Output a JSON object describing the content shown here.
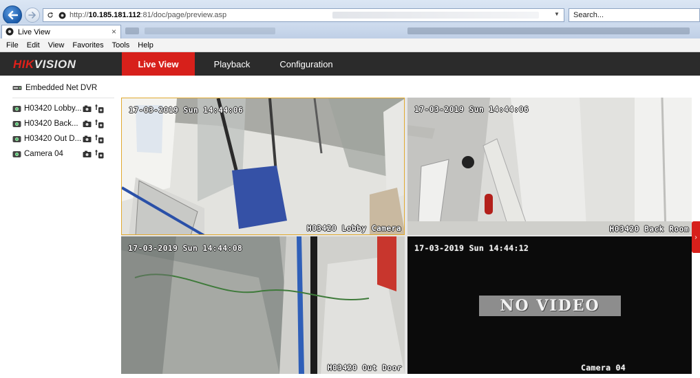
{
  "browser": {
    "url_prefix": "http://",
    "url_host": "10.185.181.112",
    "url_rest": ":81/doc/page/preview.asp",
    "search_placeholder": "Search...",
    "tab_title": "Live View",
    "tab_close": "×",
    "menu": [
      "File",
      "Edit",
      "View",
      "Favorites",
      "Tools",
      "Help"
    ]
  },
  "app": {
    "logo_red": "HIK",
    "logo_white": "VISION",
    "nav": {
      "live_view": "Live View",
      "playback": "Playback",
      "configuration": "Configuration"
    },
    "accent_color": "#d7201b",
    "header_bg": "#2b2b2b"
  },
  "tree": {
    "device": "Embedded Net DVR",
    "cameras": [
      {
        "label": "H03420 Lobby..."
      },
      {
        "label": "H03420 Back..."
      },
      {
        "label": "H03420 Out D..."
      },
      {
        "label": "Camera 04"
      }
    ]
  },
  "views": [
    {
      "timestamp": "17-03-2019 Sun 14:44:06",
      "name": "H03420 Lobby Camera"
    },
    {
      "timestamp": "17-03-2019 Sun 14:44:06",
      "name": "H03420 Back Room"
    },
    {
      "timestamp": "17-03-2019 Sun 14:44:08",
      "name": "H03420 Out Door"
    },
    {
      "timestamp": "17-03-2019 Sun 14:44:12",
      "name": "Camera 04",
      "status": "NO VIDEO"
    }
  ],
  "side_handle": "›",
  "icons": [
    "back-arrow-icon",
    "forward-arrow-icon",
    "refresh-icon",
    "site-icon",
    "dropdown-icon",
    "dvr-icon",
    "camera-icon",
    "record-icon",
    "capture-icon"
  ]
}
